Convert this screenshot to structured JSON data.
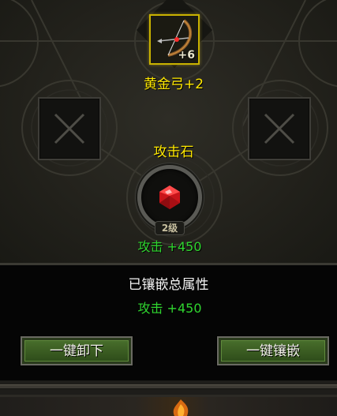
{
  "equipment": {
    "icon": "golden-bow-icon",
    "level_badge": "+6",
    "name": "黄金弓+2",
    "frame_color": "#c9b200"
  },
  "side_slots": [
    {
      "state": "empty",
      "icon": "x-mark-icon"
    },
    {
      "state": "empty",
      "icon": "x-mark-icon"
    }
  ],
  "gem": {
    "name": "攻击石",
    "icon": "red-gem-icon",
    "level": "2级",
    "stat": "攻击 +450"
  },
  "summary": {
    "title": "已镶嵌总属性",
    "stat": "攻击 +450"
  },
  "buttons": {
    "unload_all": "一键卸下",
    "inlay_all": "一键镶嵌"
  },
  "colors": {
    "name_yellow": "#ffe800",
    "stat_green": "#2fd52f",
    "button_green": "#476d2b"
  }
}
